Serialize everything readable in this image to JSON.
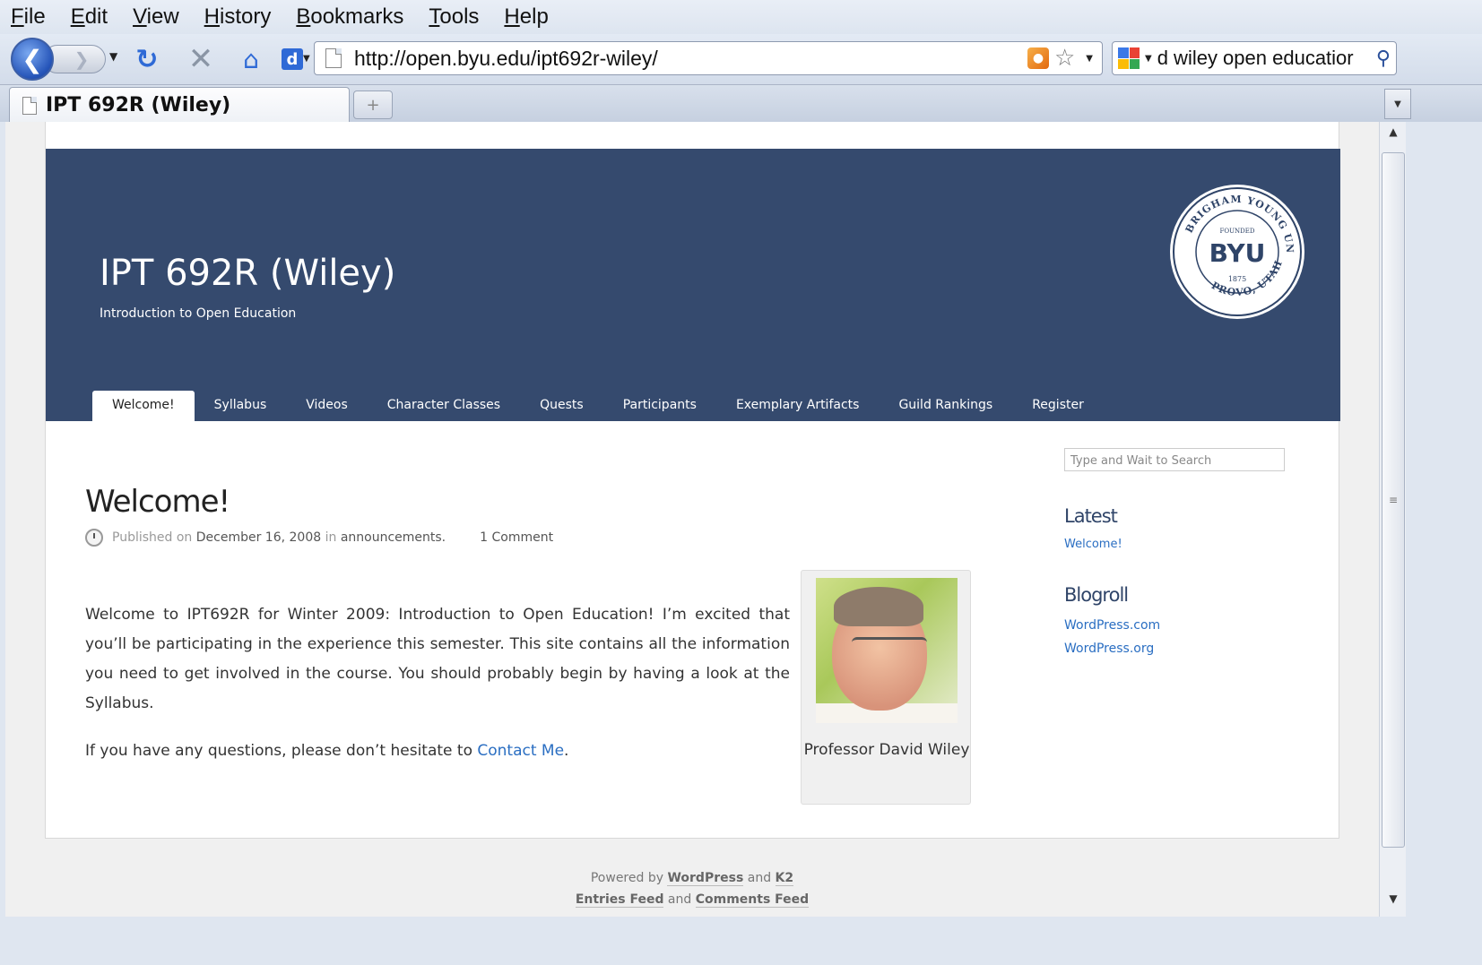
{
  "menu": [
    "File",
    "Edit",
    "View",
    "History",
    "Bookmarks",
    "Tools",
    "Help"
  ],
  "nav": {
    "url": "http://open.byu.edu/ipt692r-wiley/",
    "search_value": "d wiley open educatior"
  },
  "tab": {
    "title": "IPT 692R (Wiley)"
  },
  "site": {
    "title": "IPT 692R (Wiley)",
    "description": "Introduction to Open Education",
    "seal": {
      "top": "YOUNG UNIVERSITY",
      "left": "BRIGHAM",
      "bottom": "PROVO, UTAH",
      "founded": "FOUNDED",
      "center": "BYU",
      "year": "1875"
    }
  },
  "menu_tabs": [
    "Welcome!",
    "Syllabus",
    "Videos",
    "Character Classes",
    "Quests",
    "Participants",
    "Exemplary Artifacts",
    "Guild Rankings",
    "Register"
  ],
  "post": {
    "title": "Welcome!",
    "meta_published": "Published on",
    "meta_date": "December 16, 2008",
    "meta_in": "in",
    "meta_category": "announcements.",
    "meta_comments": "1 Comment",
    "para1": "Welcome to IPT692R for Winter 2009: Introduction to Open Education! I’m excited that you’ll be participating in the experience this semester. This site contains all the information you need to get involved in the course. You should probably begin by having a look at the Syllabus.",
    "para2_prefix": "If you have any questions, please don’t hesitate to ",
    "para2_link": "Contact Me",
    "para2_suffix": ".",
    "photo_caption": "Professor David Wiley"
  },
  "sidebar": {
    "search_placeholder": "Type and Wait to Search",
    "latest_title": "Latest",
    "latest_items": [
      "Welcome!"
    ],
    "blogroll_title": "Blogroll",
    "blogroll_items": [
      "WordPress.com",
      "WordPress.org"
    ]
  },
  "footer": {
    "powered_by": "Powered by",
    "wordpress": "WordPress",
    "and1": "and",
    "k2": "K2",
    "entries_feed": "Entries Feed",
    "and2": "and",
    "comments_feed": "Comments Feed"
  }
}
